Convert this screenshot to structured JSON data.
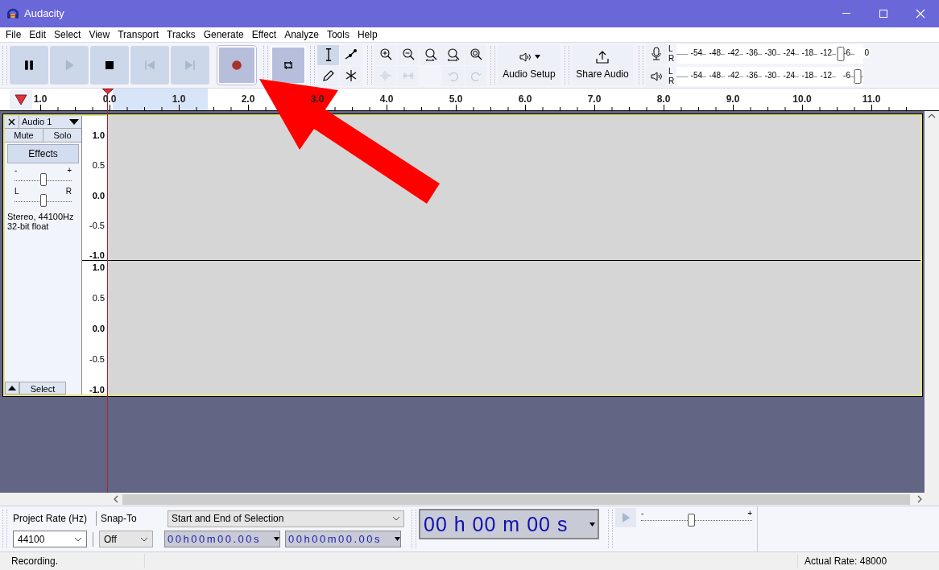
{
  "window": {
    "title": "Audacity"
  },
  "menu": [
    "File",
    "Edit",
    "Select",
    "View",
    "Transport",
    "Tracks",
    "Generate",
    "Effect",
    "Analyze",
    "Tools",
    "Help"
  ],
  "transport": [
    {
      "kind": "pause",
      "disabled": false,
      "pressed": false
    },
    {
      "kind": "play",
      "disabled": true,
      "pressed": false
    },
    {
      "kind": "stop",
      "disabled": false,
      "pressed": false
    },
    {
      "kind": "skip_start",
      "disabled": true,
      "pressed": false
    },
    {
      "kind": "skip_end",
      "disabled": true,
      "pressed": false
    },
    {
      "kind": "record",
      "disabled": false,
      "pressed": true
    }
  ],
  "tools": [
    {
      "kind": "select",
      "selected": true
    },
    {
      "kind": "envelope",
      "selected": false
    },
    {
      "kind": "draw",
      "selected": false
    },
    {
      "kind": "multi",
      "selected": false
    }
  ],
  "edit_tools": [
    {
      "kind": "zoom_in",
      "disabled": false
    },
    {
      "kind": "zoom_out",
      "disabled": false
    },
    {
      "kind": "fit_selection",
      "disabled": false
    },
    {
      "kind": "fit_project",
      "disabled": false
    },
    {
      "kind": "zoom_toggle",
      "disabled": false
    },
    {
      "kind": "trim",
      "disabled": true
    },
    {
      "kind": "silence",
      "disabled": true
    },
    {
      "kind": "spacer"
    },
    {
      "kind": "undo",
      "disabled": true
    },
    {
      "kind": "redo",
      "disabled": true
    }
  ],
  "audio_setup": {
    "label": "Audio Setup"
  },
  "share": {
    "label": "Share Audio"
  },
  "meters": [
    {
      "kind": "record",
      "channels": [
        "L",
        "R"
      ],
      "ticks": [
        "-54",
        "-48",
        "-42",
        "-36",
        "-30",
        "-24",
        "-18",
        "-12",
        "-6",
        "0"
      ],
      "level": 0.88
    },
    {
      "kind": "playback",
      "channels": [
        "L",
        "R"
      ],
      "ticks": [
        "-54",
        "-48",
        "-42",
        "-36",
        "-30",
        "-24",
        "-18",
        "-12",
        "-6"
      ],
      "level": 0.97
    }
  ],
  "ruler": {
    "labels": [
      "1.0",
      "0.0",
      "1.0",
      "2.0",
      "3.0",
      "4.0",
      "5.0",
      "6.0",
      "7.0",
      "8.0",
      "9.0",
      "10.0",
      "11.0"
    ]
  },
  "track": {
    "name": "Audio 1",
    "mute": "Mute",
    "solo": "Solo",
    "effects": "Effects",
    "gain": {
      "min": "-",
      "max": "+",
      "level": 0.5
    },
    "pan": {
      "min": "L",
      "max": "R",
      "level": 0.5
    },
    "info": [
      "Stereo, 44100Hz",
      "32-bit float"
    ],
    "select": "Select",
    "channels": [
      {
        "scale": [
          "1.0",
          "0.5",
          "0.0",
          "-0.5",
          "-1.0"
        ]
      },
      {
        "scale": [
          "1.0",
          "0.5",
          "0.0",
          "-0.5",
          "-1.0"
        ]
      }
    ]
  },
  "selection_toolbar": {
    "rate_label": "Project Rate (Hz)",
    "rate": "44100",
    "snap_label": "Snap-To",
    "snap": "Off",
    "mode": "Start and End of Selection",
    "start": "00h00m00.00s",
    "end": "00h00m00.00s"
  },
  "time": "00 h 00 m 00 s",
  "play_at_speed": {
    "min": "-",
    "max": "+",
    "level": 0.45
  },
  "status": {
    "message": "Recording.",
    "rate": "Actual Rate: 48000"
  }
}
